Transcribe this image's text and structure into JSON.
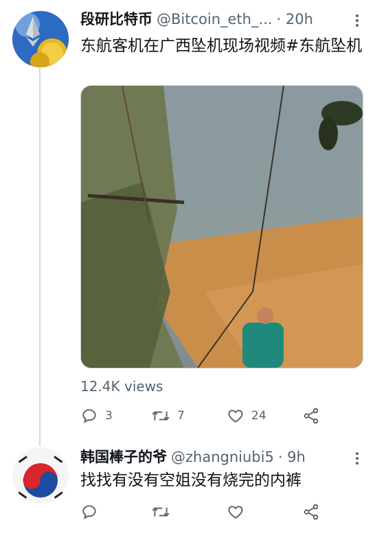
{
  "tweet": {
    "name": "段研比特币",
    "handle": "@Bitcoin_eth_...",
    "time": "· 20h",
    "text": "东航客机在广西坠机现场视频#东航坠机",
    "views": "12.4K views",
    "replies": "3",
    "retweets": "7",
    "likes": "24"
  },
  "reply": {
    "name": "韩国棒子的爷",
    "handle": "@zhangniubi5",
    "time": "· 9h",
    "text": "找找有没有空姐没有烧完的内裤"
  },
  "icons": [
    "more-icon",
    "reply-icon",
    "retweet-icon",
    "like-icon",
    "share-icon"
  ],
  "colors": {
    "text": "#0f1419",
    "secondary": "#536471",
    "thread": "#cfd9de"
  }
}
